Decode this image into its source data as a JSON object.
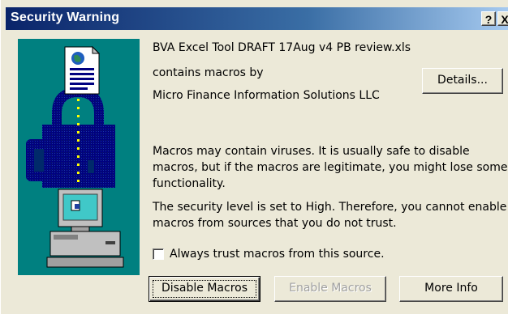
{
  "dialog": {
    "title": "Security Warning",
    "help_button": "?",
    "close_button": "X"
  },
  "file_name": "BVA Excel Tool DRAFT  17Aug v4 PB review.xls",
  "contains_macros_by": "contains macros by",
  "publisher": "Micro Finance Information Solutions LLC",
  "details_button": "Details...",
  "warning_line1": "Macros may contain viruses. It is usually safe to disable",
  "warning_line2": "macros, but if the macros are legitimate, you might lose some",
  "warning_line3": "functionality.",
  "security_line1": "The security level is set to High.  Therefore, you cannot enable",
  "security_line2": "macros from sources that you do not trust.",
  "trust_checkbox": {
    "label": "Always trust macros from this source.",
    "checked": false
  },
  "buttons": {
    "disable": "Disable Macros",
    "enable": "Enable Macros",
    "more_info": "More Info"
  },
  "graphic": {
    "background": "#008080",
    "icons": [
      "document-icon",
      "padlock-icon",
      "computer-icon"
    ]
  }
}
